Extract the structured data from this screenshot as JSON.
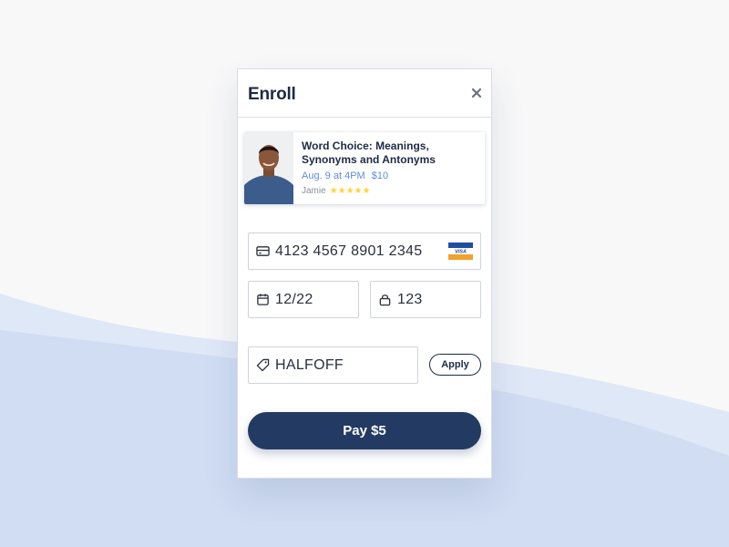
{
  "modal": {
    "title": "Enroll",
    "close_icon": "close-icon"
  },
  "course": {
    "title": "Word Choice: Meanings, Synonyms and Antonyms",
    "date": "Aug. 9 at 4PM",
    "price": "$10",
    "tutor": "Jamie",
    "stars": "★★★★★",
    "rating": 5
  },
  "payment": {
    "card_number": "4123 4567 8901 2345",
    "card_brand": "VISA",
    "expiry": "12/22",
    "cvc": "123",
    "promo_code": "HALFOFF",
    "apply_label": "Apply",
    "pay_label": "Pay $5"
  },
  "icons": {
    "card": "credit-card-icon",
    "calendar": "calendar-icon",
    "lock": "lock-icon",
    "tag": "tag-icon",
    "visa": "visa-logo"
  },
  "colors": {
    "accent": "#233a62",
    "link": "#5b8ee0",
    "star": "#ffd43b",
    "wave_light": "#dfe8f7",
    "wave_dark": "#d0ddf3"
  }
}
